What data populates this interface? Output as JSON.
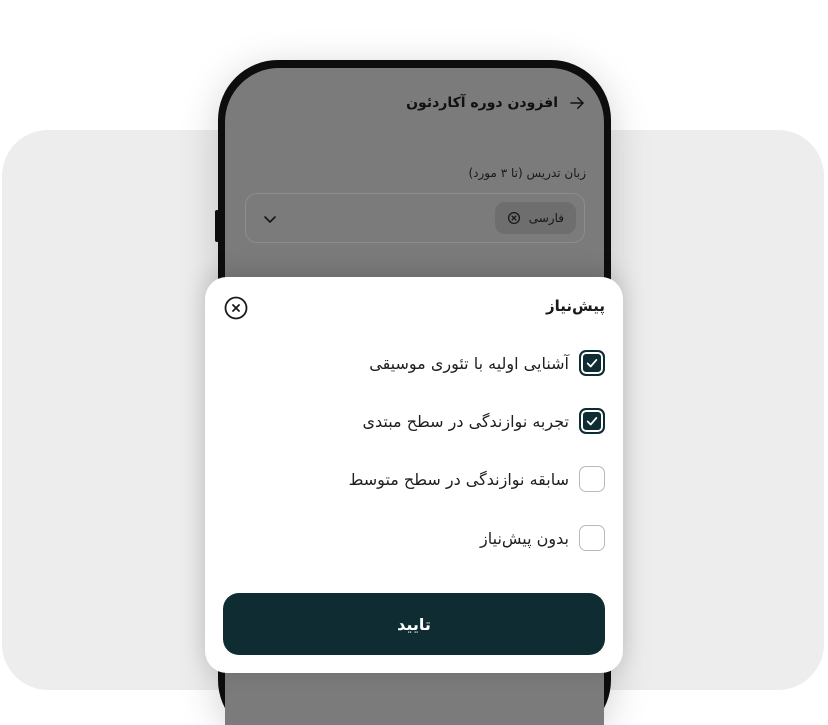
{
  "colors": {
    "primary": "#0f2c33",
    "panel_bg": "#ededed",
    "overlay": "#7b7b7b",
    "sheet_bg": "#ffffff"
  },
  "header": {
    "title": "افزودن دوره آکاردئون",
    "back_icon": "arrow-right-icon"
  },
  "form": {
    "language_label": "زبان تدریس (تا ۳ مورد)",
    "selected_chip": "فارسی",
    "chip_remove_icon": "circle-x-icon",
    "dropdown_icon": "chevron-down-icon"
  },
  "sheet": {
    "title": "پیش‌نیاز",
    "close_icon": "circle-close-icon",
    "options": [
      {
        "label": "آشنایی اولیه با تئوری موسیقی",
        "checked": true
      },
      {
        "label": "تجربه نوازندگی در سطح مبتدی",
        "checked": true
      },
      {
        "label": "سابقه نوازندگی در سطح متوسط",
        "checked": false
      },
      {
        "label": "بدون پیش‌نیاز",
        "checked": false
      }
    ],
    "confirm_label": "تایید"
  }
}
